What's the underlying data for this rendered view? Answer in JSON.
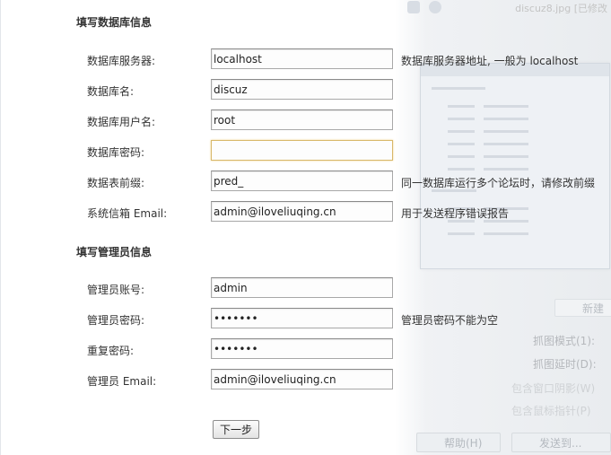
{
  "background_window": {
    "title": "discuz8.jpg [已修改",
    "new_button": "新建",
    "labels": [
      "抓图模式(1):",
      "抓图延时(D):",
      "包含窗口阴影(W)",
      "包含鼠标指针(P)"
    ],
    "help_button": "帮助(H)",
    "send_button": "发送到..."
  },
  "db_section": {
    "title": "填写数据库信息",
    "rows": [
      {
        "label": "数据库服务器:",
        "value": "localhost",
        "hint": "数据库服务器地址, 一般为 localhost",
        "type": "text"
      },
      {
        "label": "数据库名:",
        "value": "discuz",
        "hint": "",
        "type": "text"
      },
      {
        "label": "数据库用户名:",
        "value": "root",
        "hint": "",
        "type": "text"
      },
      {
        "label": "数据库密码:",
        "value": "",
        "hint": "",
        "type": "password"
      },
      {
        "label": "数据表前缀:",
        "value": "pred_",
        "hint": "同一数据库运行多个论坛时，请修改前缀",
        "type": "text"
      },
      {
        "label": "系统信箱 Email:",
        "value": "admin@iloveliuqing.cn",
        "hint": "用于发送程序错误报告",
        "type": "text"
      }
    ]
  },
  "admin_section": {
    "title": "填写管理员信息",
    "rows": [
      {
        "label": "管理员账号:",
        "value": "admin",
        "hint": "",
        "type": "text"
      },
      {
        "label": "管理员密码:",
        "value": "1234567",
        "hint": "管理员密码不能为空",
        "type": "password"
      },
      {
        "label": "重复密码:",
        "value": "1234567",
        "hint": "",
        "type": "password"
      },
      {
        "label": "管理员 Email:",
        "value": "admin@iloveliuqing.cn",
        "hint": "",
        "type": "text"
      }
    ]
  },
  "next_button": "下一步"
}
